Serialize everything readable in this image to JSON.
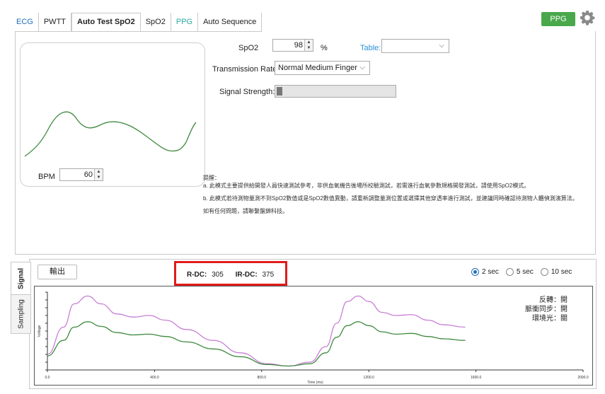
{
  "tabs": [
    {
      "label": "ECG",
      "style": "blue"
    },
    {
      "label": "PWTT",
      "style": ""
    },
    {
      "label": "Auto Test SpO2",
      "style": "active"
    },
    {
      "label": "SpO2",
      "style": ""
    },
    {
      "label": "PPG",
      "style": "teal"
    },
    {
      "label": "Auto Sequence",
      "style": ""
    }
  ],
  "header": {
    "ppg_badge": "PPG",
    "settings_icon": "gear-icon",
    "badge_color": "#4aa84c"
  },
  "waveform": {
    "bpm_label": "BPM",
    "bpm_value": "60"
  },
  "controls": {
    "spo2_label": "SpO2",
    "spo2_value": "98",
    "spo2_unit": "%",
    "table_label": "Table:",
    "table_value": "",
    "transmission_label": "Transmission Rate",
    "transmission_value": "Normal Medium Finger",
    "signal_label": "Signal Strength:",
    "signal_level": 0.05
  },
  "notes": {
    "heading": "提醒：",
    "a": "a. 此模式主要提供給開發人員快速測試參考，非供血氧機告後場所校驗測試，若需進行血氧參數規格開發測試，請使用SpO2模式。",
    "b": "b. 此模式若待測物量測不到SpO2數值或是SpO2數值異動，請重新調整量測位置或選擇其他穿透率進行測試，並建議同時確認待測物人體偵測演算法。",
    "c": "如有任何問題，請聯繫盤錦科技。"
  },
  "side_tabs": {
    "signal": "Signal",
    "sampling": "Sampling"
  },
  "lower": {
    "export_label": "輸出",
    "rdc_label": "R-DC:",
    "rdc_value": "305",
    "irdc_label": "IR-DC:",
    "irdc_value": "375",
    "highlight_color": "#e11b1b",
    "radios": [
      {
        "label": "2 sec",
        "checked": true
      },
      {
        "label": "5 sec",
        "checked": false
      },
      {
        "label": "10 sec",
        "checked": false
      }
    ]
  },
  "chart_data": {
    "type": "line",
    "xlabel": "Time (ms)",
    "ylabel": "Voltage",
    "xlim": [
      0,
      2000
    ],
    "x_ticks": [
      "0.0",
      "400.0",
      "800.0",
      "1200.0",
      "1600.0",
      "2000.0"
    ],
    "series": [
      {
        "color": "#c77fd6",
        "x": [
          0,
          60,
          100,
          150,
          200,
          260,
          320,
          380,
          440,
          520,
          620,
          720,
          820,
          900,
          980,
          1040,
          1080,
          1120,
          1160,
          1200,
          1250,
          1300,
          1360,
          1420,
          1480,
          1560
        ],
        "y": [
          0.2,
          0.55,
          0.85,
          0.95,
          0.85,
          0.72,
          0.68,
          0.7,
          0.64,
          0.52,
          0.38,
          0.22,
          0.08,
          0.05,
          0.1,
          0.3,
          0.6,
          0.88,
          0.95,
          0.88,
          0.74,
          0.7,
          0.71,
          0.64,
          0.58,
          0.55
        ]
      },
      {
        "color": "#3e8a3e",
        "x": [
          0,
          60,
          100,
          150,
          200,
          260,
          320,
          380,
          440,
          520,
          620,
          720,
          820,
          900,
          980,
          1040,
          1080,
          1120,
          1160,
          1200,
          1250,
          1300,
          1360,
          1420,
          1480,
          1560
        ],
        "y": [
          0.18,
          0.38,
          0.55,
          0.62,
          0.56,
          0.48,
          0.45,
          0.46,
          0.43,
          0.36,
          0.27,
          0.17,
          0.07,
          0.05,
          0.08,
          0.22,
          0.42,
          0.57,
          0.62,
          0.57,
          0.49,
          0.46,
          0.47,
          0.43,
          0.4,
          0.38
        ]
      }
    ]
  },
  "status": {
    "line1": "反轉：開",
    "line2": "脈衝同步：開",
    "line3": "環境光：關"
  }
}
